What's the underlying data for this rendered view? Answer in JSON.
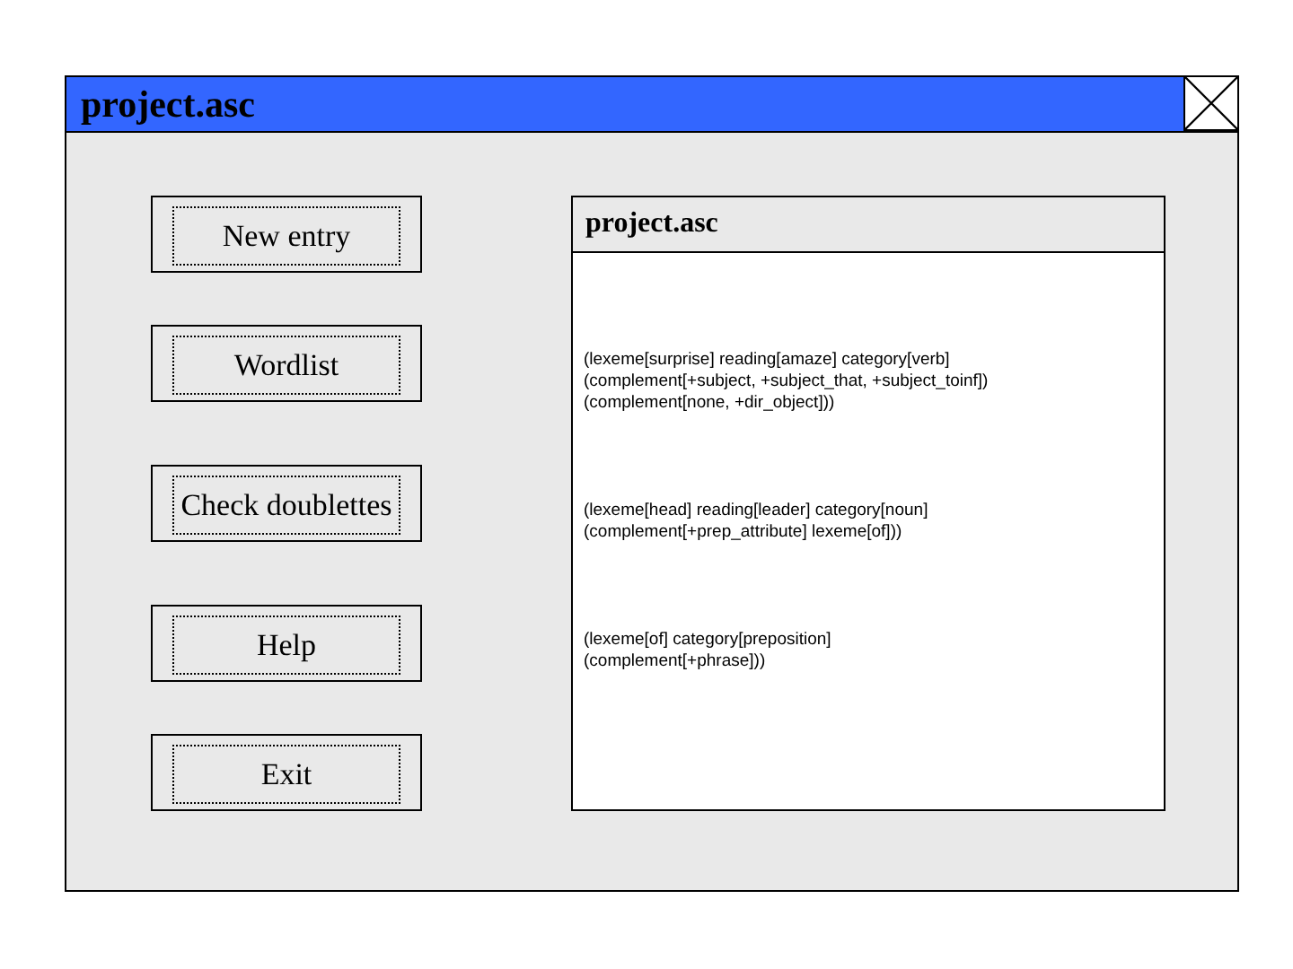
{
  "window": {
    "title": "project.asc"
  },
  "buttons": [
    {
      "label": "New entry"
    },
    {
      "label": "Wordlist"
    },
    {
      "label": "Check doublettes"
    },
    {
      "label": "Help"
    },
    {
      "label": "Exit"
    }
  ],
  "document": {
    "title": "project.asc",
    "entries": [
      [
        "(lexeme[surprise] reading[amaze] category[verb]",
        "(complement[+subject, +subject_that, +subject_toinf])",
        "(complement[none, +dir_object]))"
      ],
      [
        "(lexeme[head] reading[leader] category[noun]",
        "(complement[+prep_attribute] lexeme[of]))"
      ],
      [
        "(lexeme[of] category[preposition]",
        "(complement[+phrase]))"
      ]
    ]
  }
}
